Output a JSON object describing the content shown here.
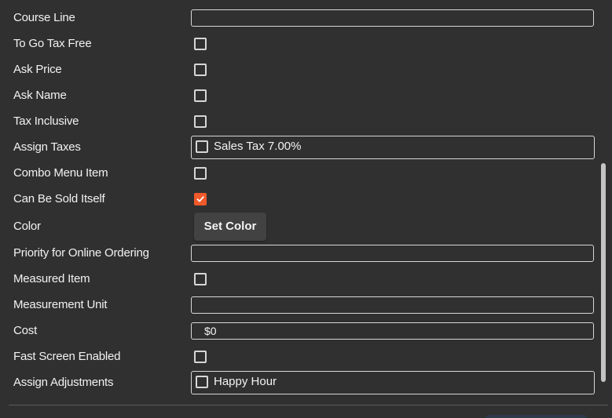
{
  "form": {
    "course_line": {
      "label": "Course Line",
      "value": ""
    },
    "to_go_tax_free": {
      "label": "To Go Tax Free",
      "checked": false
    },
    "ask_price": {
      "label": "Ask Price",
      "checked": false
    },
    "ask_name": {
      "label": "Ask Name",
      "checked": false
    },
    "tax_inclusive": {
      "label": "Tax Inclusive",
      "checked": false
    },
    "assign_taxes": {
      "label": "Assign Taxes",
      "options": [
        {
          "label": "Sales Tax 7.00%",
          "checked": false
        }
      ]
    },
    "combo_menu_item": {
      "label": "Combo Menu Item",
      "checked": false
    },
    "can_be_sold_itself": {
      "label": "Can Be Sold Itself",
      "checked": true
    },
    "color": {
      "label": "Color",
      "button_label": "Set Color"
    },
    "priority_online_ordering": {
      "label": "Priority for Online Ordering",
      "value": ""
    },
    "measured_item": {
      "label": "Measured Item",
      "checked": false
    },
    "measurement_unit": {
      "label": "Measurement Unit",
      "value": ""
    },
    "cost": {
      "label": "Cost",
      "value": "$0"
    },
    "fast_screen_enabled": {
      "label": "Fast Screen Enabled",
      "checked": false
    },
    "assign_adjustments": {
      "label": "Assign Adjustments",
      "options": [
        {
          "label": "Happy Hour",
          "checked": false
        }
      ]
    }
  },
  "colors": {
    "background": "#303030",
    "text": "#f3f3f3",
    "border": "#d8d8d8",
    "accent": "#f05a2a",
    "button": "#424242"
  },
  "icons": {
    "checked_checkbox": "check-icon"
  }
}
